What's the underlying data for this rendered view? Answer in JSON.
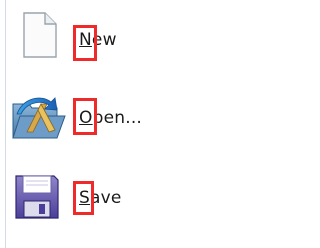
{
  "menu": {
    "items": [
      {
        "name": "new",
        "accel": "N",
        "rest": "ew",
        "icon": "new-document-icon"
      },
      {
        "name": "open",
        "accel": "O",
        "rest": "pen...",
        "icon": "open-folder-icon"
      },
      {
        "name": "save",
        "accel": "S",
        "rest": "ave",
        "icon": "floppy-disk-icon"
      }
    ],
    "highlight_color": "#ee2a2a"
  }
}
